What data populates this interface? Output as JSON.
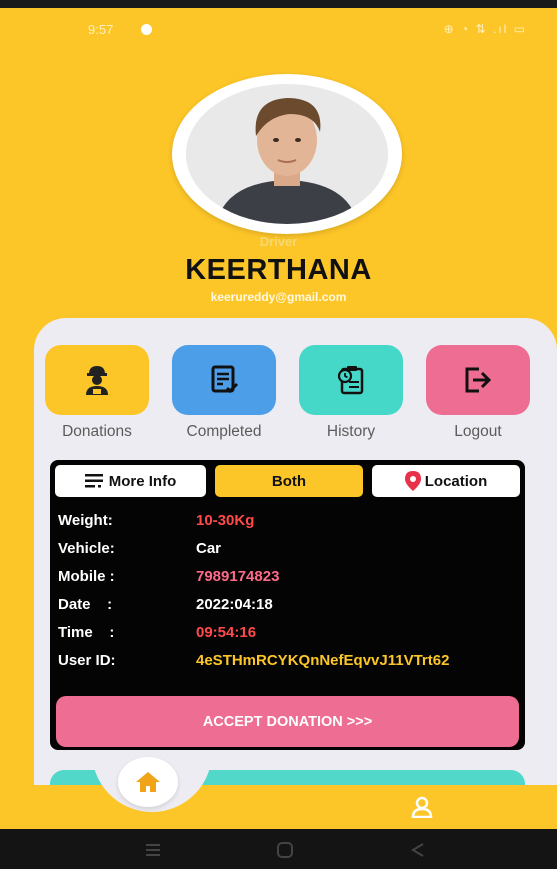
{
  "status_bar": {
    "time": "9:57",
    "icons": "⊕ ◔ ⇅ .ıl ▭"
  },
  "profile": {
    "role": "Driver",
    "name": "KEERTHANA",
    "email": "keerureddy@gmail.com",
    "avatar_icon": "person-photo"
  },
  "actions": [
    {
      "label": "Donations",
      "icon": "delivery-person-icon",
      "color": "#fdc628"
    },
    {
      "label": "Completed",
      "icon": "completed-list-icon",
      "color": "#4d9ee8"
    },
    {
      "label": "History",
      "icon": "history-clipboard-icon",
      "color": "#45d8c8"
    },
    {
      "label": "Logout",
      "icon": "logout-icon",
      "color": "#ee6d92"
    }
  ],
  "info_tabs": {
    "more_info": "More Info",
    "both": "Both",
    "location": "Location"
  },
  "details": [
    {
      "label": "Weight:",
      "value": "10-30Kg",
      "color": "#ff4a4a"
    },
    {
      "label": "Vehicle:",
      "value": "Car",
      "color": "#ffffff"
    },
    {
      "label": "Mobile :",
      "value": "7989174823",
      "color": "#ff6a8a"
    },
    {
      "label": "Date    :",
      "value": "2022:04:18",
      "color": "#ffffff"
    },
    {
      "label": "Time    :",
      "value": "09:54:16",
      "color": "#ff4a4a"
    },
    {
      "label": "User ID:",
      "value": "4eSTHmRCYKQnNefEqvvJ11VTrt62",
      "color": "#fdc628"
    }
  ],
  "accept_button": "ACCEPT DONATION >>>",
  "colors": {
    "primary": "#fdc628",
    "accent_pink": "#ee6d92",
    "accent_teal": "#45d8c8",
    "accent_blue": "#4d9ee8"
  }
}
